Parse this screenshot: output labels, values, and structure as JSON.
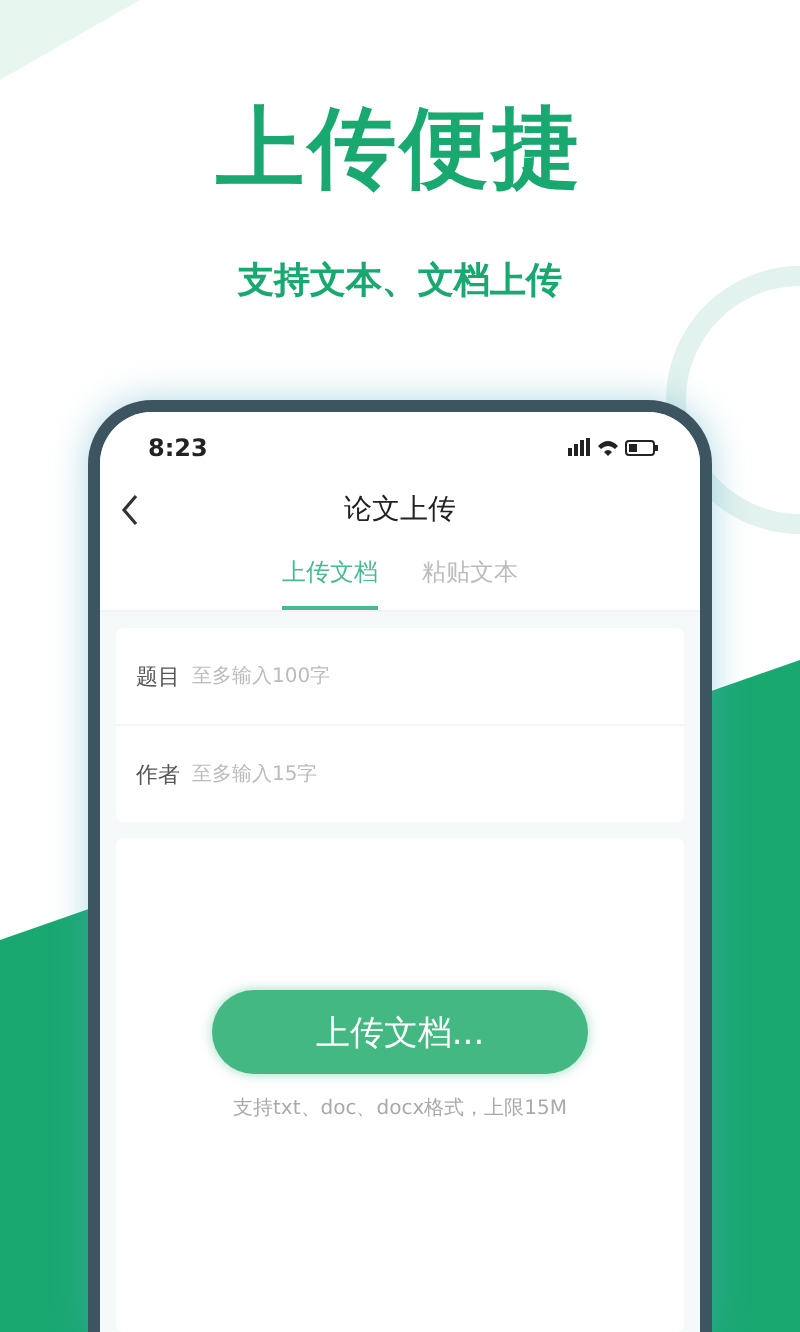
{
  "headline": "上传便捷",
  "subheadline": "支持文本、文档上传",
  "status_bar": {
    "time": "8:23"
  },
  "nav": {
    "title": "论文上传"
  },
  "tabs": [
    {
      "label": "上传文档",
      "selected": true
    },
    {
      "label": "粘贴文本",
      "selected": false
    }
  ],
  "fields": [
    {
      "label": "题目",
      "placeholder": "至多输入100字"
    },
    {
      "label": "作者",
      "placeholder": "至多输入15字"
    }
  ],
  "upload": {
    "button": "上传文档...",
    "hint": "支持txt、doc、docx格式，上限15M"
  }
}
